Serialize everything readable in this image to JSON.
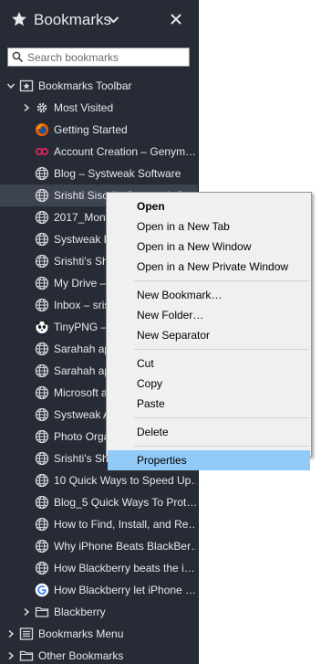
{
  "sidebar": {
    "title": "Bookmarks",
    "search_placeholder": "Search bookmarks",
    "colors": {
      "background": "#272b35",
      "text": "#e6e8ec",
      "selected_row": "#3d4350",
      "menu_highlight": "#91c9f7"
    }
  },
  "tree": [
    {
      "label": "Bookmarks Toolbar",
      "icon": "bookmarks-toolbar-icon",
      "depth": 0,
      "twisty": "expanded"
    },
    {
      "label": "Most Visited",
      "icon": "gear-icon",
      "depth": 1,
      "twisty": "collapsed"
    },
    {
      "label": "Getting Started",
      "icon": "firefox-icon",
      "depth": 1
    },
    {
      "label": "Account Creation – Genym…",
      "icon": "genymotion-icon",
      "depth": 1
    },
    {
      "label": "Blog – Systweak Software",
      "icon": "globe-icon",
      "depth": 1
    },
    {
      "label": "Srishti Sisodia Systweak S…",
      "icon": "globe-icon",
      "depth": 1,
      "selected": true
    },
    {
      "label": "2017_Mont…",
      "icon": "globe-icon",
      "depth": 1
    },
    {
      "label": "Systweak B…",
      "icon": "globe-icon",
      "depth": 1
    },
    {
      "label": "Srishti's Sh…",
      "icon": "globe-icon",
      "depth": 1
    },
    {
      "label": "My Drive – …",
      "icon": "globe-icon",
      "depth": 1
    },
    {
      "label": "Inbox – sris…",
      "icon": "globe-icon",
      "depth": 1
    },
    {
      "label": "TinyPNG –…",
      "icon": "tinypng-panda-icon",
      "depth": 1
    },
    {
      "label": "Sarahah ap…",
      "icon": "globe-icon",
      "depth": 1
    },
    {
      "label": "Sarahah ap…",
      "icon": "globe-icon",
      "depth": 1
    },
    {
      "label": "Microsoft a…",
      "icon": "globe-icon",
      "depth": 1
    },
    {
      "label": "Systweak A…",
      "icon": "globe-icon",
      "depth": 1
    },
    {
      "label": "Photo Orga…",
      "icon": "globe-icon",
      "depth": 1
    },
    {
      "label": "Srishti's Sheet – Google She…",
      "icon": "globe-icon",
      "depth": 1
    },
    {
      "label": "10 Quick Ways to Speed Up…",
      "icon": "globe-icon",
      "depth": 1
    },
    {
      "label": "Blog_5 Quick Ways To Prot…",
      "icon": "globe-icon",
      "depth": 1
    },
    {
      "label": "How to Find, Install, and Re…",
      "icon": "globe-icon",
      "depth": 1
    },
    {
      "label": "Why iPhone Beats BlackBer…",
      "icon": "globe-icon",
      "depth": 1
    },
    {
      "label": "How Blackberry beats the i…",
      "icon": "globe-icon",
      "depth": 1
    },
    {
      "label": "How Blackberry let iPhone …",
      "icon": "google-icon",
      "depth": 1
    },
    {
      "label": "Blackberry",
      "icon": "folder-icon",
      "depth": 1,
      "twisty": "collapsed"
    },
    {
      "label": "Bookmarks Menu",
      "icon": "bookmarks-menu-icon",
      "depth": 0,
      "twisty": "collapsed"
    },
    {
      "label": "Other Bookmarks",
      "icon": "folder-icon",
      "depth": 0,
      "twisty": "collapsed"
    }
  ],
  "context_menu": {
    "items": [
      {
        "type": "item",
        "label": "Open",
        "bold": true
      },
      {
        "type": "item",
        "label": "Open in a New Tab"
      },
      {
        "type": "item",
        "label": "Open in a New Window"
      },
      {
        "type": "item",
        "label": "Open in a New Private Window"
      },
      {
        "type": "separator"
      },
      {
        "type": "item",
        "label": "New Bookmark…"
      },
      {
        "type": "item",
        "label": "New Folder…"
      },
      {
        "type": "item",
        "label": "New Separator"
      },
      {
        "type": "separator"
      },
      {
        "type": "item",
        "label": "Cut"
      },
      {
        "type": "item",
        "label": "Copy"
      },
      {
        "type": "item",
        "label": "Paste"
      },
      {
        "type": "separator"
      },
      {
        "type": "item",
        "label": "Delete"
      },
      {
        "type": "separator"
      },
      {
        "type": "item",
        "label": "Properties",
        "highlighted": true
      }
    ]
  }
}
